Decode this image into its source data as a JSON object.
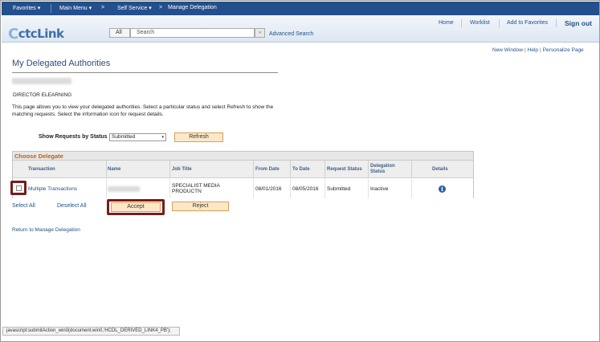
{
  "nav": {
    "favorites": "Favorites ▾",
    "main_menu": "Main Menu ▾",
    "self_service": "Self Service ▾",
    "arrow": ">",
    "manage_delegation": "Manage Delegation"
  },
  "header": {
    "logo_c": "C",
    "logo_text": "ctcLink",
    "search_scope": "All",
    "search_placeholder": "Search",
    "search_go": "»",
    "advanced_search": "Advanced Search",
    "home": "Home",
    "worklist": "Worklist",
    "add_to_favorites": "Add to Favorites",
    "sign_out": "Sign out"
  },
  "toplinks": {
    "new_window": "New Window",
    "help": "Help",
    "personalize": "Personalize Page",
    "sep": "|"
  },
  "page": {
    "title": "My Delegated Authorities",
    "section": "DIRECTOR ELEARNING",
    "instructions": "This page allows you to view your delegated authorities. Select a particular status and select Refresh to show the matching requests. Select the information icon for request details."
  },
  "filter": {
    "label": "Show Requests by Status",
    "value": "Submitted",
    "arrow": "▾",
    "refresh": "Refresh"
  },
  "grid": {
    "title": "Choose Delegate",
    "columns": {
      "transaction": "Transaction",
      "name": "Name",
      "job_title": "Job Title",
      "from_date": "From Date",
      "to_date": "To Date",
      "request_status": "Request Status",
      "delegation_status": "Delegation Status",
      "details": "Details"
    },
    "row": {
      "transaction": "Multiple Transactions",
      "job_title": "SPECIALIST MEDIA PRODUCTN",
      "from_date": "08/01/2016",
      "to_date": "08/05/2016",
      "request_status": "Submitted",
      "delegation_status": "Inactive",
      "details_icon": "info-icon",
      "details_glyph": "i"
    }
  },
  "actions": {
    "select_all": "Select All",
    "deselect_all": "Deselect All",
    "accept": "Accept",
    "reject": "Reject",
    "return": "Return to Manage Delegation"
  },
  "statusbar": {
    "text": "javascript:submitAction_win0(document.win0,'HCDL_DERIVED_LINK4_PB');"
  },
  "colors": {
    "nav_bg": "#234f8c",
    "link": "#21528b",
    "button_bg": "#fce8c8",
    "highlight": "#7a1b1b",
    "grid_title": "#b5621a"
  }
}
